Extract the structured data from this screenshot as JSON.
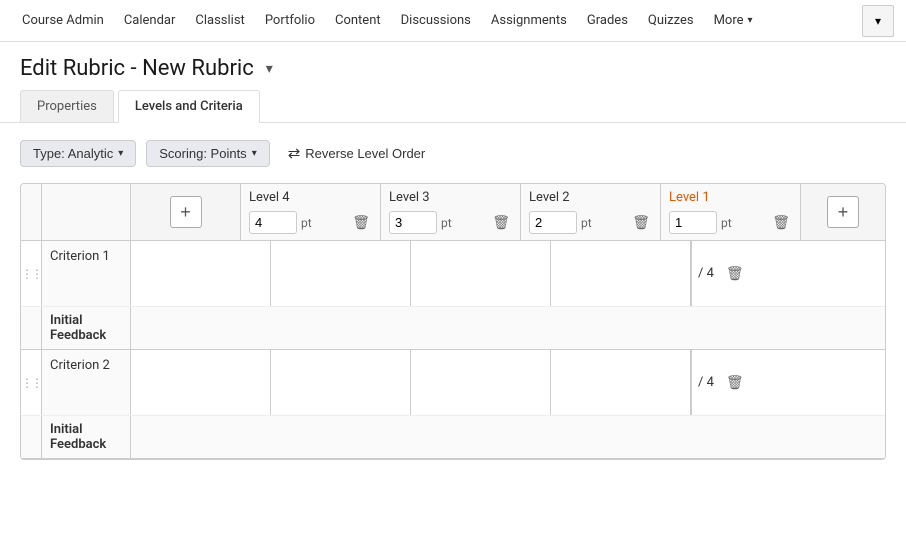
{
  "nav": {
    "items": [
      {
        "label": "Course Admin",
        "id": "course-admin"
      },
      {
        "label": "Calendar",
        "id": "calendar"
      },
      {
        "label": "Classlist",
        "id": "classlist"
      },
      {
        "label": "Portfolio",
        "id": "portfolio"
      },
      {
        "label": "Content",
        "id": "content"
      },
      {
        "label": "Discussions",
        "id": "discussions"
      },
      {
        "label": "Assignments",
        "id": "assignments"
      },
      {
        "label": "Grades",
        "id": "grades"
      },
      {
        "label": "Quizzes",
        "id": "quizzes"
      },
      {
        "label": "More",
        "id": "more"
      }
    ]
  },
  "page": {
    "title": "Edit Rubric - New Rubric",
    "title_dropdown_aria": "Page options"
  },
  "tabs": [
    {
      "label": "Properties",
      "id": "properties",
      "active": false
    },
    {
      "label": "Levels and Criteria",
      "id": "levels-criteria",
      "active": true
    }
  ],
  "toolbar": {
    "type_label": "Type: Analytic",
    "scoring_label": "Scoring: Points",
    "reverse_label": "Reverse Level Order"
  },
  "levels": [
    {
      "name": "Level 4",
      "points": "4",
      "id": "level-4"
    },
    {
      "name": "Level 3",
      "points": "3",
      "id": "level-3"
    },
    {
      "name": "Level 2",
      "points": "2",
      "id": "level-2"
    },
    {
      "name": "Level 1",
      "points": "1",
      "id": "level-1"
    }
  ],
  "criteria": [
    {
      "name": "Criterion 1",
      "score": "/ 4",
      "feedback_label": "Initial Feedback"
    },
    {
      "name": "Criterion 2",
      "score": "/ 4",
      "feedback_label": "Initial Feedback"
    }
  ],
  "icons": {
    "drag": "⋮⋮",
    "add": "+",
    "delete": "🗑",
    "chevron_down": "▾",
    "reverse": "⇄"
  }
}
